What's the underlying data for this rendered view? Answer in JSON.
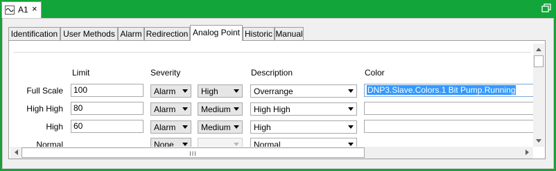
{
  "window": {
    "doc_tab_title": "A1",
    "close_glyph": "×",
    "icon": "waveform-icon",
    "restore_icon": "restore-window-icon",
    "accent": "#12a53a"
  },
  "tabs": [
    {
      "label": "Identification"
    },
    {
      "label": "User Methods"
    },
    {
      "label": "Alarm"
    },
    {
      "label": "Redirection"
    },
    {
      "label": "Analog Point"
    },
    {
      "label": "Historic"
    },
    {
      "label": "Manual"
    }
  ],
  "active_tab": "Analog Point",
  "columns": {
    "limit": "Limit",
    "severity": "Severity",
    "description": "Description",
    "color": "Color"
  },
  "rows": [
    {
      "label": "Full Scale",
      "limit": "100",
      "severity": "Alarm",
      "priority": "High",
      "description": "Overrange",
      "color": "DNP3.Slave.Colors.1 Bit Pump.Running"
    },
    {
      "label": "High High",
      "limit": "80",
      "severity": "Alarm",
      "priority": "Medium",
      "description": "High High",
      "color": ""
    },
    {
      "label": "High",
      "limit": "60",
      "severity": "Alarm",
      "priority": "Medium",
      "description": "High",
      "color": ""
    },
    {
      "label": "Normal",
      "limit": "",
      "severity": "None",
      "priority": "",
      "description": "Normal",
      "color": ""
    }
  ],
  "scrollbar": {
    "grip": "III"
  }
}
